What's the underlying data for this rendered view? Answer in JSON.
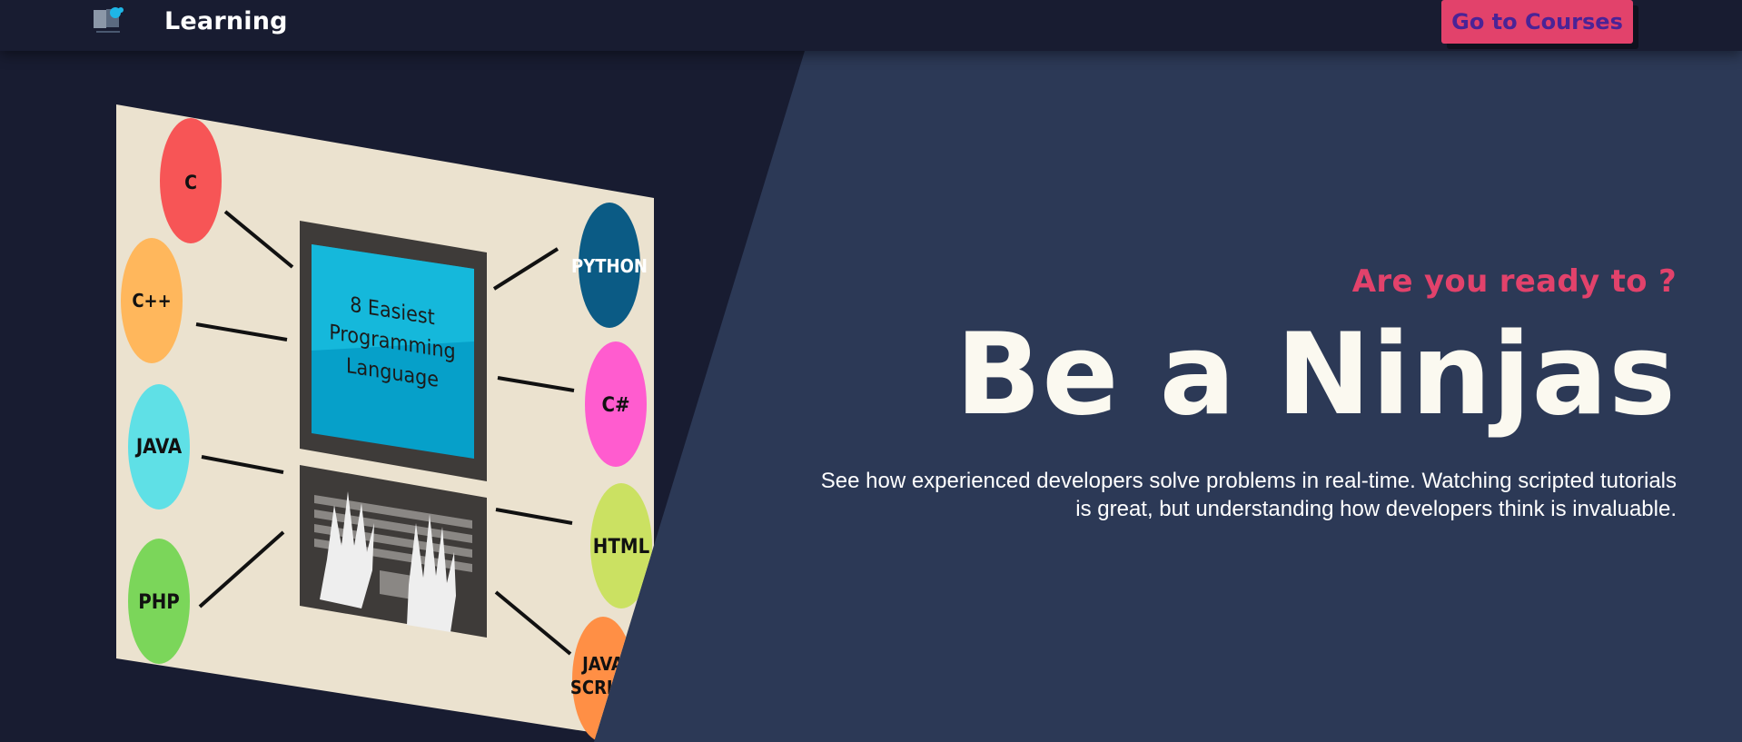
{
  "nav": {
    "logo_icon": "learning-logo-icon",
    "brand": "Learning",
    "cta_label": "Go to Courses"
  },
  "hero": {
    "kicker": "Are you ready to ?",
    "headline": "Be a Ninjas",
    "description": "See how experienced developers solve problems in real-time. Watching scripted tutorials is great, but understanding how developers think is invaluable."
  },
  "illustration": {
    "screen_title": [
      "8 Easiest",
      "Programming",
      "Language"
    ],
    "languages": [
      "C",
      "C++",
      "JAVA",
      "PHP",
      "PYTHON",
      "C#",
      "HTML",
      "JAVA SCRIPT"
    ]
  },
  "colors": {
    "background": "#181c31",
    "panel": "#2c3956",
    "accent": "#e2426b",
    "button_text": "#4b2396",
    "headline": "#fbf9f0"
  }
}
